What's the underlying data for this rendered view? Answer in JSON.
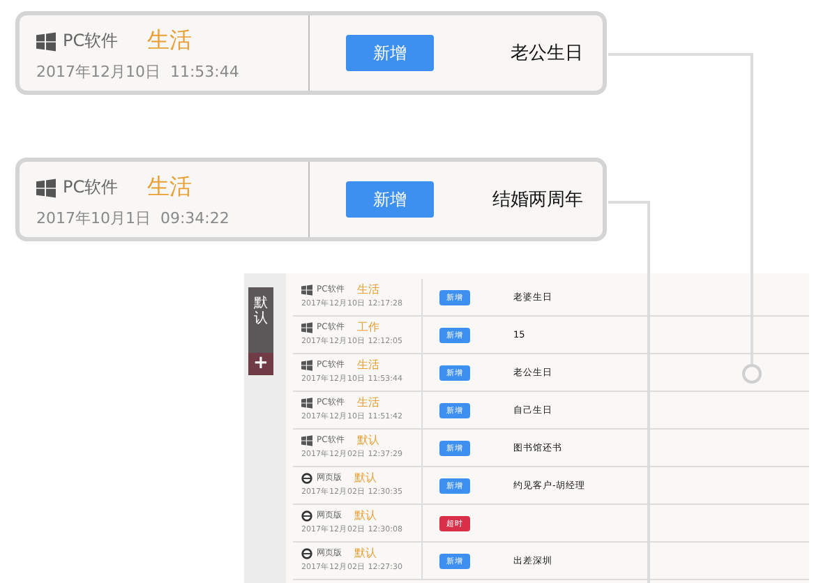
{
  "cards": [
    {
      "kind": "pc",
      "source": "PC软件",
      "category": "生活",
      "time": "2017年12月10日  11:53:44",
      "button": "新增",
      "title": "老公生日"
    },
    {
      "kind": "pc",
      "source": "PC软件",
      "category": "生活",
      "time": "2017年10月1日  09:34:22",
      "button": "新增",
      "title": "结婚两周年"
    }
  ],
  "table": {
    "sidebar": {
      "tab": "默认",
      "add": "+"
    },
    "rows": [
      {
        "kind": "pc",
        "source": "PC软件",
        "category": "生活",
        "time": "2017年12月10日 12:17:28",
        "button": {
          "kind": "new",
          "label": "新增"
        },
        "title": "老婆生日"
      },
      {
        "kind": "pc",
        "source": "PC软件",
        "category": "工作",
        "time": "2017年12月10日 12:12:05",
        "button": {
          "kind": "new",
          "label": "新增"
        },
        "title": "15"
      },
      {
        "kind": "pc",
        "source": "PC软件",
        "category": "生活",
        "time": "2017年12月10日 11:53:44",
        "button": {
          "kind": "new",
          "label": "新增"
        },
        "title": "老公生日"
      },
      {
        "kind": "pc",
        "source": "PC软件",
        "category": "生活",
        "time": "2017年12月10日 11:51:42",
        "button": {
          "kind": "new",
          "label": "新增"
        },
        "title": "自己生日"
      },
      {
        "kind": "pc",
        "source": "PC软件",
        "category": "默认",
        "time": "2017年12月02日 12:37:29",
        "button": {
          "kind": "new",
          "label": "新增"
        },
        "title": "图书馆还书"
      },
      {
        "kind": "web",
        "source": "网页版",
        "category": "默认",
        "time": "2017年12月02日 12:30:35",
        "button": {
          "kind": "new",
          "label": "新增"
        },
        "title": "约见客户-胡经理"
      },
      {
        "kind": "web",
        "source": "网页版",
        "category": "默认",
        "time": "2017年12月02日 12:30:08",
        "button": {
          "kind": "overdue",
          "label": "超时"
        }
      },
      {
        "kind": "web",
        "source": "网页版",
        "category": "默认",
        "time": "2017年12月02日 12:27:30",
        "button": {
          "kind": "new",
          "label": "新增"
        },
        "title": "出差深圳"
      }
    ]
  }
}
